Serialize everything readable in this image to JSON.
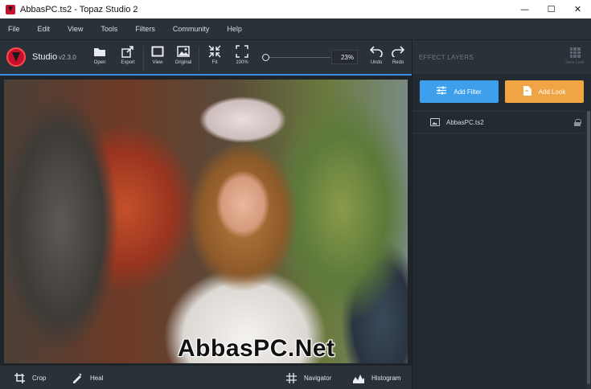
{
  "window": {
    "title": "AbbasPC.ts2 - Topaz Studio 2",
    "minimize_glyph": "—",
    "maximize_glyph": "☐",
    "close_glyph": "✕"
  },
  "menu": [
    "File",
    "Edit",
    "View",
    "Tools",
    "Filters",
    "Community",
    "Help"
  ],
  "toolbar": {
    "brand": "Studio",
    "version": "v2.3.0",
    "buttons": {
      "open": "Open",
      "export": "Export",
      "view": "View",
      "original": "Original",
      "fit": "Fit",
      "zoom_100": "100%",
      "undo": "Undo",
      "redo": "Redo"
    },
    "zoom_value": "23%"
  },
  "canvas": {
    "watermark": "AbbasPC.Net"
  },
  "bottombar": {
    "crop": "Crop",
    "heal": "Heal",
    "navigator": "Navigator",
    "histogram": "Histogram"
  },
  "right_panel": {
    "title": "EFFECT LAYERS",
    "save_look": "Save Look",
    "add_filter": "Add Filter",
    "add_look": "Add Look",
    "layers": [
      {
        "name": "AbbasPC.ts2",
        "locked": true
      }
    ]
  },
  "colors": {
    "accent_blue": "#3ea0ec",
    "accent_orange": "#f0a443",
    "brand_red": "#c8102e",
    "panel_bg": "#232a31",
    "toolbar_bg": "#2b3138"
  },
  "icons": [
    "app-icon",
    "minimize-icon",
    "maximize-icon",
    "close-icon",
    "topaz-logo",
    "folder-icon",
    "export-icon",
    "view-icon",
    "original-icon",
    "fit-icon",
    "zoom-100-icon",
    "undo-icon",
    "redo-icon",
    "crop-icon",
    "heal-icon",
    "navigator-icon",
    "histogram-icon",
    "save-look-icon",
    "add-filter-icon",
    "add-look-icon",
    "image-layer-icon",
    "lock-icon"
  ]
}
